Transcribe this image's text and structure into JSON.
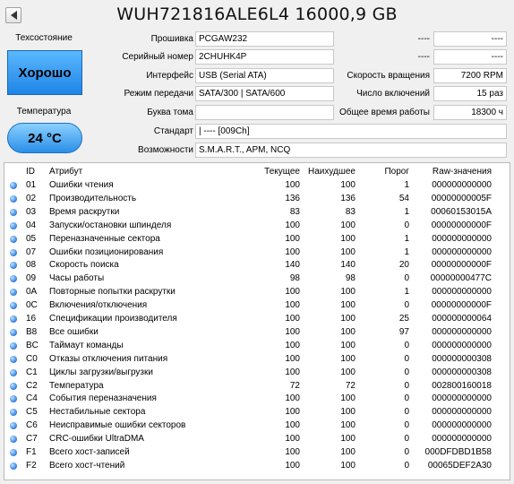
{
  "title": "WUH721816ALE6L4 16000,9 GB",
  "health": {
    "caption": "Техсостояние",
    "value": "Хорошо"
  },
  "temperature": {
    "caption": "Температура",
    "value": "24 °C"
  },
  "info": {
    "firmware_label": "Прошивка",
    "firmware": "PCGAW232",
    "serial_label": "Серийный номер",
    "serial": "2CHUHK4P",
    "interface_label": "Интерфейс",
    "interface": "USB (Serial ATA)",
    "transfer_label": "Режим передачи",
    "transfer": "SATA/300 | SATA/600",
    "volume_label": "Буква тома",
    "volume": "",
    "standard_label": "Стандарт",
    "standard": "| ---- [009Ch]",
    "features_label": "Возможности",
    "features": "S.M.A.R.T., APM, NCQ",
    "right_top1_label": "----",
    "right_top1": "----",
    "right_top2_label": "----",
    "right_top2": "----",
    "rpm_label": "Скорость вращения",
    "rpm": "7200 RPM",
    "power_count_label": "Число включений",
    "power_count": "15 раз",
    "power_hours_label": "Общее время работы",
    "power_hours": "18300 ч"
  },
  "columns": {
    "id": "ID",
    "name": "Атрибут",
    "current": "Текущее",
    "worst": "Наихудшее",
    "threshold": "Порог",
    "raw": "Raw-значения"
  },
  "rows": [
    {
      "id": "01",
      "name": "Ошибки чтения",
      "current": "100",
      "worst": "100",
      "threshold": "1",
      "raw": "000000000000"
    },
    {
      "id": "02",
      "name": "Производительность",
      "current": "136",
      "worst": "136",
      "threshold": "54",
      "raw": "00000000005F"
    },
    {
      "id": "03",
      "name": "Время раскрутки",
      "current": "83",
      "worst": "83",
      "threshold": "1",
      "raw": "00060153015A"
    },
    {
      "id": "04",
      "name": "Запуски/остановки шпинделя",
      "current": "100",
      "worst": "100",
      "threshold": "0",
      "raw": "00000000000F"
    },
    {
      "id": "05",
      "name": "Переназначенные сектора",
      "current": "100",
      "worst": "100",
      "threshold": "1",
      "raw": "000000000000"
    },
    {
      "id": "07",
      "name": "Ошибки позиционирования",
      "current": "100",
      "worst": "100",
      "threshold": "1",
      "raw": "000000000000"
    },
    {
      "id": "08",
      "name": "Скорость поиска",
      "current": "140",
      "worst": "140",
      "threshold": "20",
      "raw": "00000000000F"
    },
    {
      "id": "09",
      "name": "Часы работы",
      "current": "98",
      "worst": "98",
      "threshold": "0",
      "raw": "00000000477C"
    },
    {
      "id": "0A",
      "name": "Повторные попытки раскрутки",
      "current": "100",
      "worst": "100",
      "threshold": "1",
      "raw": "000000000000"
    },
    {
      "id": "0C",
      "name": "Включения/отключения",
      "current": "100",
      "worst": "100",
      "threshold": "0",
      "raw": "00000000000F"
    },
    {
      "id": "16",
      "name": "Спецификации производителя",
      "current": "100",
      "worst": "100",
      "threshold": "25",
      "raw": "000000000064"
    },
    {
      "id": "B8",
      "name": "Все ошибки",
      "current": "100",
      "worst": "100",
      "threshold": "97",
      "raw": "000000000000"
    },
    {
      "id": "BC",
      "name": "Таймаут команды",
      "current": "100",
      "worst": "100",
      "threshold": "0",
      "raw": "000000000000"
    },
    {
      "id": "C0",
      "name": "Отказы отключения питания",
      "current": "100",
      "worst": "100",
      "threshold": "0",
      "raw": "000000000308"
    },
    {
      "id": "C1",
      "name": "Циклы загрузки/выгрузки",
      "current": "100",
      "worst": "100",
      "threshold": "0",
      "raw": "000000000308"
    },
    {
      "id": "C2",
      "name": "Температура",
      "current": "72",
      "worst": "72",
      "threshold": "0",
      "raw": "002800160018"
    },
    {
      "id": "C4",
      "name": "События переназначения",
      "current": "100",
      "worst": "100",
      "threshold": "0",
      "raw": "000000000000"
    },
    {
      "id": "C5",
      "name": "Нестабильные сектора",
      "current": "100",
      "worst": "100",
      "threshold": "0",
      "raw": "000000000000"
    },
    {
      "id": "C6",
      "name": "Неисправимые ошибки секторов",
      "current": "100",
      "worst": "100",
      "threshold": "0",
      "raw": "000000000000"
    },
    {
      "id": "C7",
      "name": "CRC-ошибки UltraDMA",
      "current": "100",
      "worst": "100",
      "threshold": "0",
      "raw": "000000000000"
    },
    {
      "id": "F1",
      "name": "Всего хост-записей",
      "current": "100",
      "worst": "100",
      "threshold": "0",
      "raw": "000DFDBD1B58"
    },
    {
      "id": "F2",
      "name": "Всего хост-чтений",
      "current": "100",
      "worst": "100",
      "threshold": "0",
      "raw": "00065DEF2A30"
    }
  ]
}
